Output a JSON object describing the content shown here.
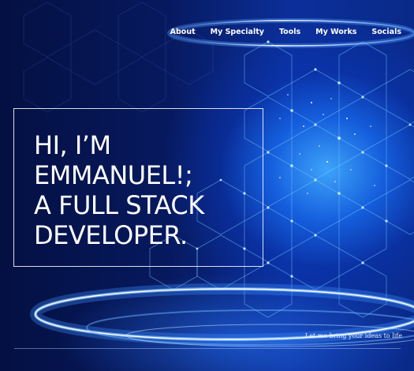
{
  "nav": {
    "items": [
      "About",
      "My Specialty",
      "Tools",
      "My Works",
      "Socials"
    ]
  },
  "hero": {
    "lines": [
      "HI, I’M",
      "EMMANUEL!;",
      "A FULL STACK",
      "DEVELOPER."
    ]
  },
  "footer": {
    "tagline": "Let me bring your ideas to life"
  }
}
